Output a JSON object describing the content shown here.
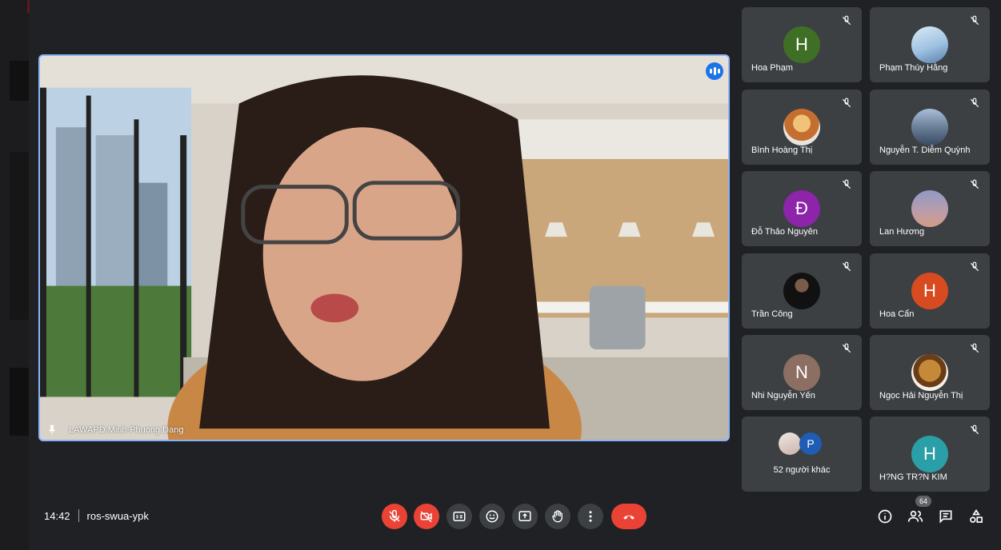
{
  "main_video": {
    "participant_name": "LAWAPD.Minh-Phuong Dang"
  },
  "participants": [
    {
      "name": "Hoa Phạm",
      "initial": "H",
      "color": "#3f6f24"
    },
    {
      "name": "Phạm Thúy Hằng",
      "initial": "",
      "color": ""
    },
    {
      "name": "Bình Hoàng Thị",
      "initial": "",
      "color": ""
    },
    {
      "name": "Nguyễn T. Diễm Quỳnh",
      "initial": "",
      "color": ""
    },
    {
      "name": "Đỗ Thảo Nguyên",
      "initial": "Đ",
      "color": "#8e24aa"
    },
    {
      "name": "Lan Hương",
      "initial": "",
      "color": ""
    },
    {
      "name": "Trần Công",
      "initial": "",
      "color": ""
    },
    {
      "name": "Hoa Cẩn",
      "initial": "H",
      "color": "#d84b20"
    },
    {
      "name": "Nhi Nguyễn Yến",
      "initial": "N",
      "color": "#8d6e63"
    },
    {
      "name": "Ngọc Hải Nguyễn Thị",
      "initial": "",
      "color": ""
    },
    {
      "name": "H?NG TR?N KIM",
      "initial": "H",
      "color": "#2a9fa8"
    }
  ],
  "others_tile": {
    "label": "52 người khác",
    "initial": "P"
  },
  "meeting": {
    "time": "14:42",
    "code": "ros-swua-ypk"
  },
  "controls": [
    {
      "name": "mic-off",
      "icon": "mic-off-icon"
    },
    {
      "name": "camera-off",
      "icon": "camera-off-icon"
    },
    {
      "name": "captions",
      "icon": "captions-icon"
    },
    {
      "name": "reactions",
      "icon": "emoji-icon"
    },
    {
      "name": "present",
      "icon": "present-icon"
    },
    {
      "name": "raise-hand",
      "icon": "hand-icon"
    },
    {
      "name": "more-options",
      "icon": "more-vert-icon"
    },
    {
      "name": "leave-call",
      "icon": "end-call-icon"
    }
  ],
  "people_count": "64",
  "colors": {
    "background": "#202124",
    "tile": "#3c4043",
    "danger": "#ea4335",
    "active_border": "#8ab4f8"
  }
}
